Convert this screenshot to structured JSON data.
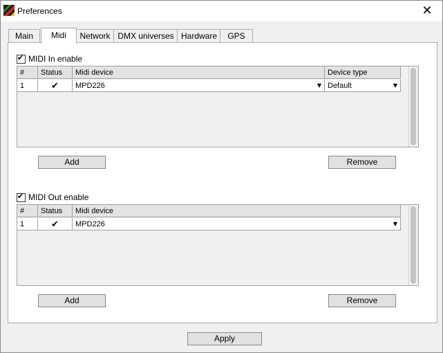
{
  "window": {
    "title": "Preferences",
    "close_glyph": "✕"
  },
  "tabs": [
    {
      "label": "Main"
    },
    {
      "label": "Midi"
    },
    {
      "label": "Network"
    },
    {
      "label": "DMX universes"
    },
    {
      "label": "Hardware"
    },
    {
      "label": "GPS"
    }
  ],
  "active_tab": "Midi",
  "midi_in": {
    "enable_label": "MIDI In enable",
    "checked": true,
    "columns": [
      "#",
      "Status",
      "Midi device",
      "Device type"
    ],
    "rows": [
      {
        "index": "1",
        "status": "✔",
        "device": "MPD226",
        "type": "Default"
      }
    ],
    "add_label": "Add",
    "remove_label": "Remove"
  },
  "midi_out": {
    "enable_label": "MIDI Out enable",
    "checked": true,
    "columns": [
      "#",
      "Status",
      "Midi device"
    ],
    "rows": [
      {
        "index": "1",
        "status": "✔",
        "device": "MPD226"
      }
    ],
    "add_label": "Add",
    "remove_label": "Remove"
  },
  "apply_label": "Apply",
  "icons": {
    "check": "✔",
    "dropdown": "▼"
  }
}
